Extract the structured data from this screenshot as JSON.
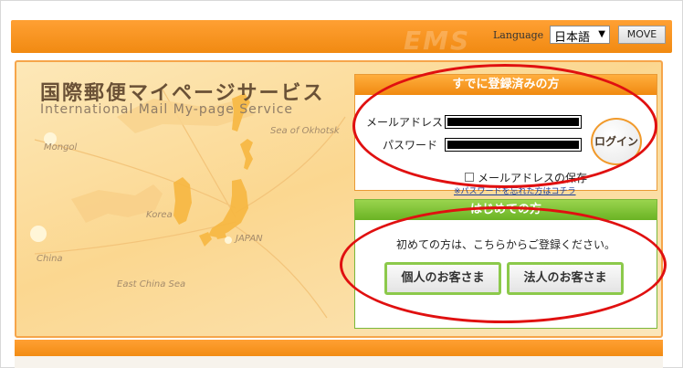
{
  "header": {
    "language_label": "Language",
    "language_selected": "日本語",
    "move_button": "MOVE",
    "watermark": "EMS"
  },
  "hero": {
    "title": "国際郵便マイページサービス",
    "subtitle": "International Mail My-page Service",
    "map_labels": {
      "okhotsk": "Sea of Okhotsk",
      "mongol": "Mongol",
      "korea": "Korea",
      "japan": "JAPAN",
      "china": "China",
      "east_china_sea": "East China Sea"
    }
  },
  "login": {
    "heading": "すでに登録済みの方",
    "email_label": "メールアドレス",
    "password_label": "パスワード",
    "login_button": "ログイン",
    "remember_label": "メールアドレスの保存",
    "forgot_link": "※パスワードを忘れた方はコチラ"
  },
  "new_user": {
    "heading": "はじめての方",
    "text": "初めての方は、こちらからご登録ください。",
    "personal_button": "個人のお客さま",
    "corporate_button": "法人のお客さま"
  },
  "colors": {
    "orange": "#f18a12",
    "green": "#6ab324",
    "annotation_red": "#e01010"
  }
}
